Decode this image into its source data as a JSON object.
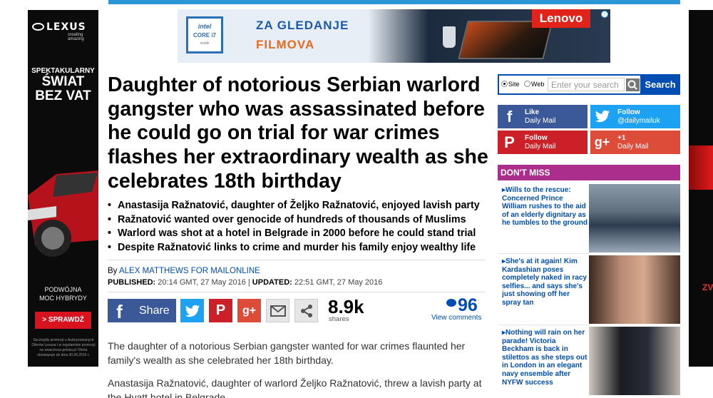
{
  "ads": {
    "left": {
      "brand": "LEXUS",
      "tagline": "creating amazing",
      "promo_line1": "SPEKTAKULARNY",
      "promo_line2": "ŚWIAT",
      "promo_line3": "BEZ VAT",
      "hybrid_line1": "PODWÓJNA",
      "hybrid_line2": "MOC HYBRYDY",
      "cta": "SPRAWDŹ",
      "fine_print": "Szczegóły promocji u Autoryzowanych Dilerów Lexusa i w regulaminie promocji na www.lexus.polska.pl Oferta obowiązuje do dnia 30.06.2016 r."
    },
    "banner": {
      "intel_brand": "intel",
      "intel_chip": "CORE i7",
      "intel_inside": "inside",
      "line1": "ZA GLEDANJE",
      "line2": "FILMOVA",
      "advertiser": "Lenovo"
    },
    "right": {
      "partial_text": "ZV"
    }
  },
  "article": {
    "headline": "Daughter of notorious Serbian warlord gangster who was assassinated before he could go on trial for war crimes flashes her extraordinary wealth as she celebrates 18th birthday",
    "bullets": [
      "Anastasija Ražnatović, daughter of Željko Ražnatović, enjoyed lavish party",
      "Ražnatović wanted over genocide of hundreds of thousands of Muslims",
      "Warlord was shot at a hotel in Belgrade in 2000 before he could stand trial",
      "Despite Ražnatović links to crime and murder his family enjoy wealthy life"
    ],
    "byline_prefix": "By",
    "author": "ALEX MATTHEWS FOR MAILONLINE",
    "published_label": "PUBLISHED:",
    "published": "20:14 GMT, 27 May 2016",
    "separator": "|",
    "updated_label": "UPDATED:",
    "updated": "22:51 GMT, 27 May 2016",
    "share": {
      "facebook_label": "Share",
      "count": "8.9k",
      "count_label": "shares",
      "comments_count": "96",
      "comments_label": "View comments"
    },
    "paragraphs": [
      "The daughter of a notorious Serbian gangster wanted for war crimes flaunted her family's wealth as she celebrated her 18th birthday.",
      "Anastasija Ražnatović, daughter of warlord Željko Ražnatović, threw a lavish party at the Hyatt hotel in Belgrade."
    ]
  },
  "sidebar": {
    "search": {
      "option_site": "Site",
      "option_web": "Web",
      "placeholder": "Enter your search",
      "button": "Search"
    },
    "social": {
      "facebook": {
        "line1": "Like",
        "line2": "Daily Mail"
      },
      "twitter": {
        "line1": "Follow",
        "line2": "@dailymailuk"
      },
      "pinterest": {
        "line1": "Follow",
        "line2": "Daily Mail"
      },
      "googleplus": {
        "line1": "+1",
        "line2": "Daily Mail"
      }
    },
    "dont_miss_title": "DON'T MISS",
    "dont_miss": [
      "Wills to the rescue: Concerned Prince William rushes to the aid of an elderly dignitary as he tumbles to the ground",
      "She's at it again! Kim Kardashian poses completely naked in racy selfies... and says she's just showing off her spray tan",
      "Nothing will rain on her parade! Victoria Beckham is back in stilettos as she steps out in London in an elegant navy ensemble after NYFW success"
    ]
  },
  "colors": {
    "accent_blue": "#004db3",
    "dont_miss_purple": "#ab2e8d",
    "facebook": "#3b5998",
    "twitter": "#1da1f2",
    "pinterest": "#cb2027",
    "googleplus": "#dd4b39"
  }
}
